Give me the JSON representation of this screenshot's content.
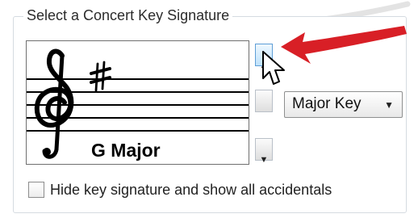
{
  "group": {
    "title": "Select a Concert Key Signature"
  },
  "preview": {
    "key_name": "G Major",
    "icons": {
      "clef": "treble-clef-icon",
      "accidental": "sharp-icon"
    }
  },
  "controls": {
    "up_icon": "chevron-up-icon",
    "down_icon": "chevron-down-icon",
    "mode_select": {
      "value": "Major Key",
      "icon": "chevron-down-icon"
    }
  },
  "options": {
    "hide_accidentals_label": "Hide key signature and show all accidentals",
    "checked": false
  },
  "overlay": {
    "annotation": "red-arrow-icon",
    "cursor": "mouse-pointer-icon",
    "accent": "#d81f26"
  }
}
